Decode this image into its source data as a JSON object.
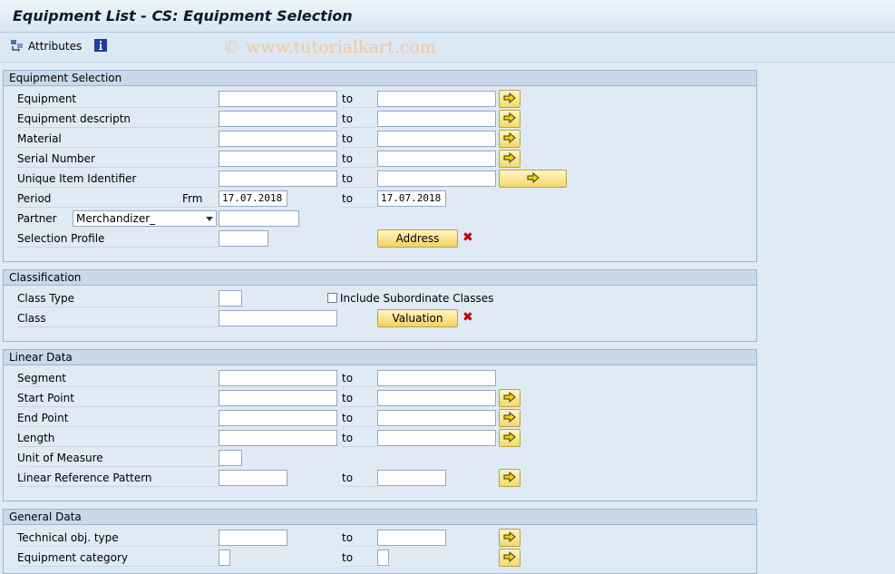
{
  "window": {
    "title": "Equipment List - CS: Equipment Selection"
  },
  "toolbar": {
    "attributes_label": "Attributes",
    "watermark": "© www.tutorialkart.com"
  },
  "equipment_selection": {
    "header": "Equipment Selection",
    "to_label": "to",
    "rows": {
      "equipment": "Equipment",
      "equipment_descr": "Equipment descriptn",
      "material": "Material",
      "serial_number": "Serial Number",
      "uii": "Unique Item Identifier",
      "period": "Period",
      "partner": "Partner",
      "selection_profile": "Selection Profile"
    },
    "period": {
      "frm_label": "Frm",
      "from_value": "17.07.2018",
      "to_value": "17.07.2018"
    },
    "partner": {
      "role_value": "Merchandizer_",
      "value": ""
    },
    "address_button": "Address"
  },
  "classification": {
    "header": "Classification",
    "class_type": "Class Type",
    "class": "Class",
    "include_subordinate": "Include Subordinate Classes",
    "include_subordinate_checked": false,
    "valuation_button": "Valuation"
  },
  "linear_data": {
    "header": "Linear Data",
    "to_label": "to",
    "segment": "Segment",
    "start_point": "Start Point",
    "end_point": "End Point",
    "length": "Length",
    "unit_of_measure": "Unit of Measure",
    "linear_reference_pattern": "Linear Reference Pattern"
  },
  "general_data": {
    "header": "General Data",
    "to_label": "to",
    "technical_obj_type": "Technical obj. type",
    "equipment_category": "Equipment category"
  },
  "icons": {
    "multiple_selection": "yellow-arrow-icon",
    "attributes": "attributes-icon",
    "info": "info-icon",
    "delete": "red-x-icon"
  }
}
